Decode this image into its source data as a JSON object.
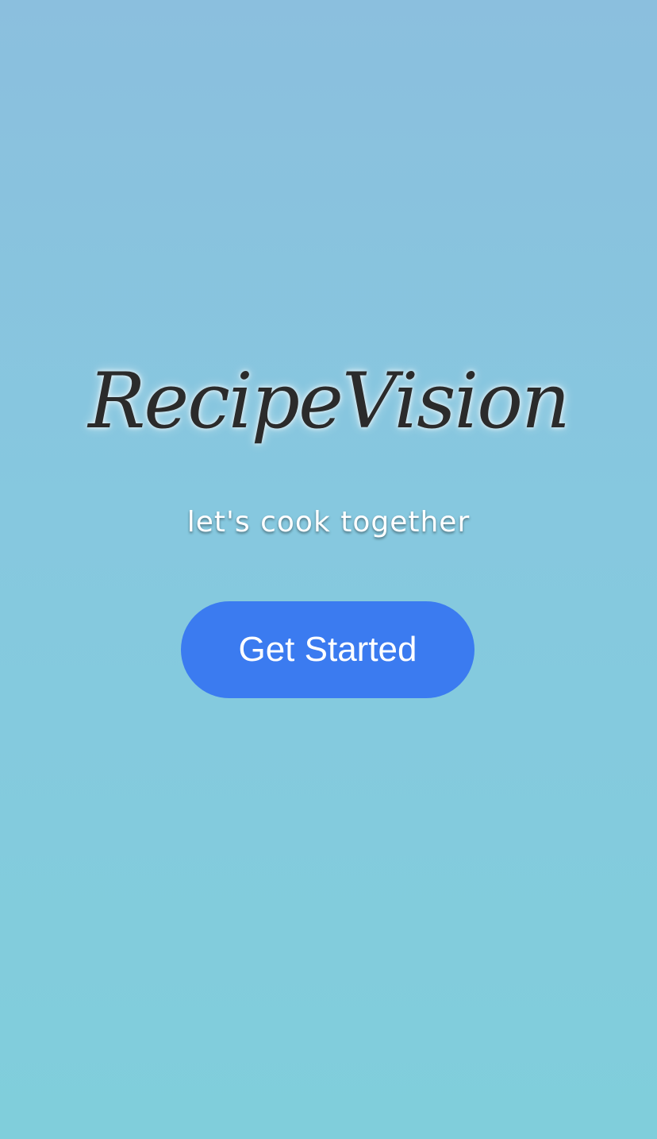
{
  "app": {
    "title": "RecipeVision",
    "tagline": "let's cook together"
  },
  "actions": {
    "get_started_label": "Get Started"
  },
  "colors": {
    "background_top": "#8bbfde",
    "background_bottom": "#80cedb",
    "button": "#3b7bf0",
    "title_text": "#2b2b2b",
    "tagline_text": "#ffffff"
  }
}
